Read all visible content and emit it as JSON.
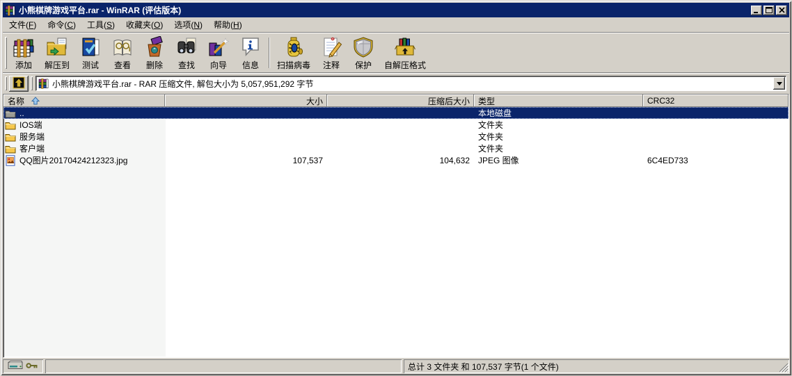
{
  "window": {
    "title": "小熊棋牌游戏平台.rar - WinRAR (评估版本)",
    "app_icon": "winrar-books-icon",
    "controls": [
      {
        "name": "minimize-button",
        "icon": "minimize-icon"
      },
      {
        "name": "maximize-button",
        "icon": "maximize-icon"
      },
      {
        "name": "close-button",
        "icon": "close-icon"
      }
    ]
  },
  "menu": {
    "items": [
      {
        "label": "文件",
        "mnemonic": "F"
      },
      {
        "label": "命令",
        "mnemonic": "C"
      },
      {
        "label": "工具",
        "mnemonic": "S"
      },
      {
        "label": "收藏夹",
        "mnemonic": "O"
      },
      {
        "label": "选项",
        "mnemonic": "N"
      },
      {
        "label": "帮助",
        "mnemonic": "H"
      }
    ]
  },
  "toolbar": {
    "buttons": [
      {
        "label": "添加",
        "icon": "add-archive-icon"
      },
      {
        "label": "解压到",
        "icon": "extract-to-icon"
      },
      {
        "label": "测试",
        "icon": "test-icon"
      },
      {
        "label": "查看",
        "icon": "view-icon"
      },
      {
        "label": "删除",
        "icon": "delete-icon"
      },
      {
        "label": "查找",
        "icon": "find-icon"
      },
      {
        "label": "向导",
        "icon": "wizard-icon"
      },
      {
        "label": "信息",
        "icon": "info-icon"
      },
      {
        "label": "扫描病毒",
        "icon": "virus-scan-icon",
        "separator_before": true
      },
      {
        "label": "注释",
        "icon": "comment-icon"
      },
      {
        "label": "保护",
        "icon": "protect-icon"
      },
      {
        "label": "自解压格式",
        "icon": "sfx-icon"
      }
    ]
  },
  "addressbar": {
    "up_icon": "up-one-level-icon",
    "archive_icon": "winrar-books-icon",
    "value": "小熊棋牌游戏平台.rar - RAR 压缩文件, 解包大小为 5,057,951,292 字节",
    "dropdown_icon": "chevron-down-icon"
  },
  "file_list": {
    "columns": [
      {
        "label": "名称",
        "align": "left",
        "sorted": "asc"
      },
      {
        "label": "大小",
        "align": "right"
      },
      {
        "label": "压缩后大小",
        "align": "right"
      },
      {
        "label": "类型",
        "align": "left"
      },
      {
        "label": "CRC32",
        "align": "left"
      }
    ],
    "rows": [
      {
        "name": "..",
        "icon": "folder-up-icon",
        "size": "",
        "packed": "",
        "type": "本地磁盘",
        "crc32": "",
        "selected": true
      },
      {
        "name": "IOS端",
        "icon": "folder-icon",
        "size": "",
        "packed": "",
        "type": "文件夹",
        "crc32": "",
        "selected": false
      },
      {
        "name": "服务端",
        "icon": "folder-icon",
        "size": "",
        "packed": "",
        "type": "文件夹",
        "crc32": "",
        "selected": false
      },
      {
        "name": "客户端",
        "icon": "folder-icon",
        "size": "",
        "packed": "",
        "type": "文件夹",
        "crc32": "",
        "selected": false
      },
      {
        "name": "QQ图片20170424212323.jpg",
        "icon": "jpeg-file-icon",
        "size": "107,537",
        "packed": "104,632",
        "type": "JPEG 图像",
        "crc32": "6C4ED733",
        "selected": false
      }
    ]
  },
  "statusbar": {
    "icons": [
      "drive-icon",
      "key-icon"
    ],
    "operation": "",
    "totals": "总计 3 文件夹 和 107,537 字节(1 个文件)"
  },
  "colors": {
    "titlebar": "#0a246a",
    "chrome": "#d4d0c8",
    "selection": "#0a246a",
    "name_column_tint": "#f5f6f5",
    "list_background": "#ffffff"
  }
}
